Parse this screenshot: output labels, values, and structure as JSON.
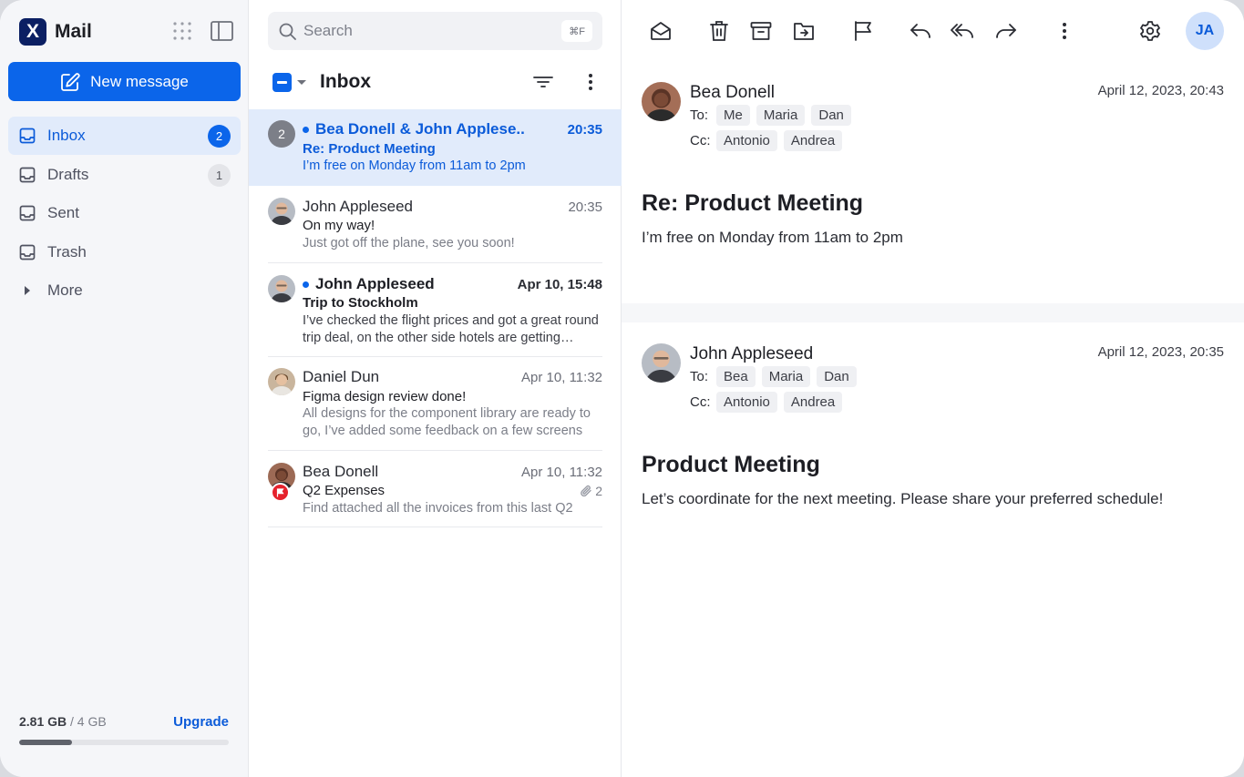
{
  "app": {
    "logo_letter": "X",
    "name": "Mail"
  },
  "sidebar": {
    "new_message_label": "New message",
    "items": [
      {
        "label": "Inbox",
        "badge": "2",
        "active": true
      },
      {
        "label": "Drafts",
        "badge": "1",
        "active": false
      },
      {
        "label": "Sent",
        "badge": "",
        "active": false
      },
      {
        "label": "Trash",
        "badge": "",
        "active": false
      },
      {
        "label": "More",
        "badge": "",
        "active": false
      }
    ],
    "storage": {
      "used": "2.81 GB",
      "total": " / 4 GB",
      "upgrade_label": "Upgrade",
      "used_fraction": 0.25
    }
  },
  "list": {
    "search_placeholder": "Search",
    "search_shortcut": "⌘F",
    "folder_title": "Inbox",
    "messages": [
      {
        "sender": "Bea Donell & John Applese...",
        "thread_count": "2",
        "time": "20:35",
        "subject": "Re: Product Meeting",
        "preview": "I’m free on Monday from 11am to 2pm",
        "unread": true,
        "selected": true
      },
      {
        "sender": "John Appleseed",
        "time": "20:35",
        "subject": "On my way!",
        "preview": "Just got off the plane, see you soon!",
        "unread": false,
        "selected": false
      },
      {
        "sender": "John Appleseed",
        "time": "Apr 10,  15:48",
        "subject": "Trip to Stockholm",
        "preview": "I’ve checked the flight prices and got a great round trip deal, on the other side hotels are getting expensive",
        "unread": true,
        "selected": false
      },
      {
        "sender": "Daniel Dun",
        "time": "Apr 10,  11:32",
        "subject": "Figma design review done!",
        "preview": "All designs for the component library are ready to go, I’ve added some feedback on a few screens",
        "unread": false,
        "selected": false
      },
      {
        "sender": "Bea Donell",
        "time": "Apr 10,  11:32",
        "subject": "Q2 Expenses",
        "preview": "Find attached all the invoices from this last Q2",
        "attachments": "2",
        "flagged": true,
        "unread": false,
        "selected": false
      }
    ]
  },
  "reader": {
    "user_initials": "JA",
    "emails": [
      {
        "from": "Bea Donell",
        "date": "April 12, 2023, 20:43",
        "to_label": "To:",
        "to": [
          "Me",
          "Maria",
          "Dan"
        ],
        "cc_label": "Cc:",
        "cc": [
          "Antonio",
          "Andrea"
        ],
        "subject": "Re: Product Meeting",
        "body": "I’m free on Monday from 11am to 2pm"
      },
      {
        "from": "John Appleseed",
        "date": "April 12, 2023, 20:35",
        "to_label": "To:",
        "to": [
          "Bea",
          "Maria",
          "Dan"
        ],
        "cc_label": "Cc:",
        "cc": [
          "Antonio",
          "Andrea"
        ],
        "subject": "Product Meeting",
        "body": "Let’s coordinate for the next meeting. Please share your preferred schedule!"
      }
    ]
  },
  "colors": {
    "accent": "#0b65ea",
    "selected_bg": "#e1ebfb",
    "flag": "#e5222c"
  }
}
